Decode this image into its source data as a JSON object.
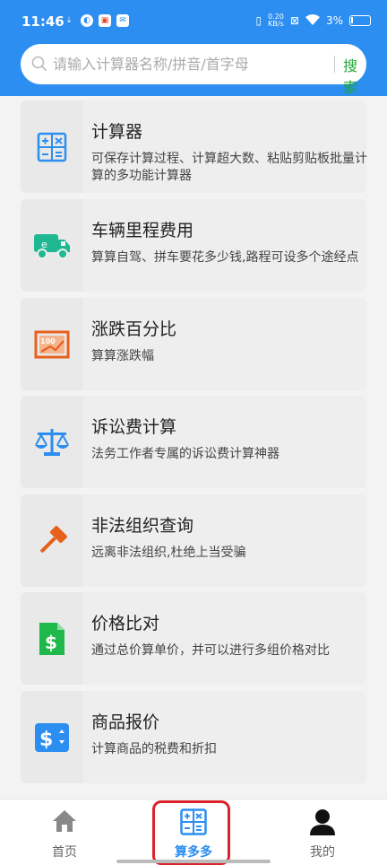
{
  "status": {
    "time": "11:46",
    "net_top": "0.20",
    "net_bottom": "KB/s",
    "battery": "3%"
  },
  "search": {
    "placeholder": "请输入计算器名称/拼音/首字母",
    "button_label": "搜索"
  },
  "tools": [
    {
      "title": "计算器",
      "desc": "可保存计算过程、计算超大数、粘贴剪贴板批量计算的多功能计算器",
      "icon": "calculator-icon"
    },
    {
      "title": "车辆里程费用",
      "desc": "算算自驾、拼车要花多少钱,路程可设多个途经点",
      "icon": "truck-icon"
    },
    {
      "title": "涨跌百分比",
      "desc": "算算涨跌幅",
      "icon": "percent-chart-icon"
    },
    {
      "title": "诉讼费计算",
      "desc": "法务工作者专属的诉讼费计算神器",
      "icon": "scales-icon"
    },
    {
      "title": "非法组织查询",
      "desc": "远离非法组织,杜绝上当受骗",
      "icon": "gavel-icon"
    },
    {
      "title": "价格比对",
      "desc": "通过总价算单价，并可以进行多组价格对比",
      "icon": "price-doc-icon"
    },
    {
      "title": "商品报价",
      "desc": "计算商品的税费和折扣",
      "icon": "dollar-tag-icon"
    }
  ],
  "tabs": [
    {
      "label": "首页",
      "icon": "home-icon"
    },
    {
      "label": "算多多",
      "icon": "calculator-icon"
    },
    {
      "label": "我的",
      "icon": "user-icon"
    }
  ],
  "colors": {
    "header_blue": "#2b8ef0",
    "search_green": "#21a63a",
    "highlight_red": "#d9232d"
  }
}
